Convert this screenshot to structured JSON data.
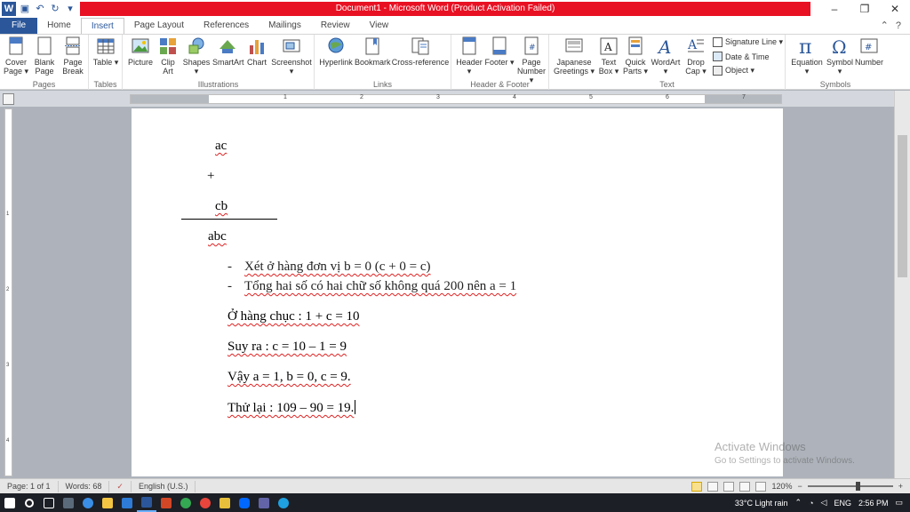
{
  "window": {
    "title": "Document1 - Microsoft Word (Product Activation Failed)",
    "controls": [
      "–",
      "❐",
      "✕"
    ]
  },
  "ribbon_tabs": [
    "File",
    "Home",
    "Insert",
    "Page Layout",
    "References",
    "Mailings",
    "Review",
    "View"
  ],
  "active_tab": "Insert",
  "ribbon": {
    "pages": {
      "label": "Pages",
      "cover": "Cover Page ▾",
      "blank": "Blank Page",
      "break": "Page Break"
    },
    "tables": {
      "label": "Tables",
      "table": "Table ▾"
    },
    "illustrations": {
      "label": "Illustrations",
      "picture": "Picture",
      "clipart": "Clip Art",
      "shapes": "Shapes ▾",
      "smartart": "SmartArt",
      "chart": "Chart",
      "screenshot": "Screenshot ▾"
    },
    "links": {
      "label": "Links",
      "hyperlink": "Hyperlink",
      "bookmark": "Bookmark",
      "crossref": "Cross-reference"
    },
    "header_footer": {
      "label": "Header & Footer",
      "header": "Header ▾",
      "footer": "Footer ▾",
      "pagenumber": "Page Number ▾"
    },
    "text": {
      "label": "Text",
      "japanese": "Japanese Greetings ▾",
      "textbox": "Text Box ▾",
      "quickparts": "Quick Parts ▾",
      "wordart": "WordArt ▾",
      "dropcap": "Drop Cap ▾",
      "signature": "Signature Line ▾",
      "datetime": "Date & Time",
      "object": "Object ▾"
    },
    "symbols": {
      "label": "Symbols",
      "equation": "Equation ▾",
      "symbol": "Symbol ▾",
      "number": "Number"
    }
  },
  "ruler": {
    "numbers": [
      "1",
      "2",
      "3",
      "4",
      "5",
      "6",
      "7"
    ]
  },
  "document": {
    "line_ac": "ac",
    "plus": "+",
    "line_cb": "cb",
    "line_abc": "abc",
    "bullet_mark": "-",
    "bullet1": "Xét ở hàng đơn vị b = 0 (c + 0 = c)",
    "bullet2": "Tổng hai số có hai chữ số không quá 200 nên a = 1",
    "para1": "Ở hàng chục : 1 + c = 10",
    "para2": "Suy ra : c = 10 – 1 = 9",
    "para3": "Vậy a = 1, b = 0, c = 9.",
    "para4": "Thử lại : 109 – 90 = 19."
  },
  "watermark": {
    "title": "Activate Windows",
    "subtitle": "Go to Settings to activate Windows."
  },
  "status": {
    "page": "Page: 1 of 1",
    "words": "Words: 68",
    "language": "English (U.S.)",
    "zoom": "120%",
    "zoom_minus": "−",
    "zoom_plus": "+"
  },
  "taskbar": {
    "weather": "33°C  Light rain",
    "lang": "ENG",
    "time": "2:56 PM"
  },
  "colors": {
    "word_blue": "#2b579a",
    "title_red": "#e81123",
    "taskbar": "#1c1f26"
  }
}
